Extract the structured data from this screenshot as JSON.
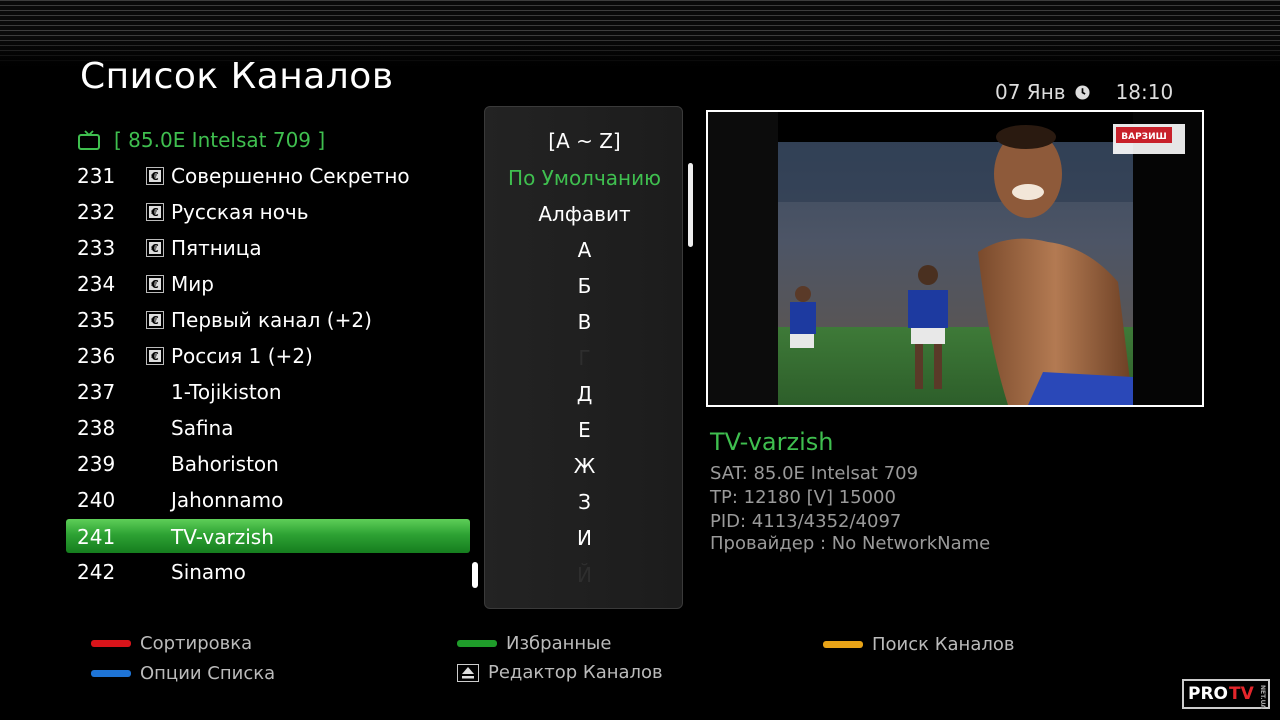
{
  "header": {
    "title": "Список Каналов",
    "date": "07 Янв",
    "time": "18:10"
  },
  "satellite": {
    "label": "[ 85.0E Intelsat 709 ]"
  },
  "channels": [
    {
      "number": "231",
      "name": "Совершенно Секретно",
      "scrambled": true,
      "selected": false
    },
    {
      "number": "232",
      "name": "Русская ночь",
      "scrambled": true,
      "selected": false
    },
    {
      "number": "233",
      "name": "Пятница",
      "scrambled": true,
      "selected": false
    },
    {
      "number": "234",
      "name": "Мир",
      "scrambled": true,
      "selected": false
    },
    {
      "number": "235",
      "name": "Первый канал (+2)",
      "scrambled": true,
      "selected": false
    },
    {
      "number": "236",
      "name": "Россия 1 (+2)",
      "scrambled": true,
      "selected": false
    },
    {
      "number": "237",
      "name": "1-Tojikiston",
      "scrambled": false,
      "selected": false
    },
    {
      "number": "238",
      "name": "Safina",
      "scrambled": false,
      "selected": false
    },
    {
      "number": "239",
      "name": "Bahoriston",
      "scrambled": false,
      "selected": false
    },
    {
      "number": "240",
      "name": "Jahonnamo",
      "scrambled": false,
      "selected": false
    },
    {
      "number": "241",
      "name": "TV-varzish",
      "scrambled": false,
      "selected": true
    },
    {
      "number": "242",
      "name": "Sinamo",
      "scrambled": false,
      "selected": false
    }
  ],
  "sort_panel": {
    "items": [
      {
        "label": "[A ~ Z]",
        "state": "normal"
      },
      {
        "label": "По Умолчанию",
        "state": "active"
      },
      {
        "label": "Алфавит",
        "state": "normal"
      },
      {
        "label": "А",
        "state": "normal"
      },
      {
        "label": "Б",
        "state": "normal"
      },
      {
        "label": "В",
        "state": "normal"
      },
      {
        "label": "Г",
        "state": "disabled"
      },
      {
        "label": "Д",
        "state": "normal"
      },
      {
        "label": "Е",
        "state": "normal"
      },
      {
        "label": "Ж",
        "state": "normal"
      },
      {
        "label": "З",
        "state": "normal"
      },
      {
        "label": "И",
        "state": "normal"
      },
      {
        "label": "Й",
        "state": "disabled"
      }
    ]
  },
  "preview": {
    "overlay_logo": "ВАРЗИШ"
  },
  "channel_info": {
    "name": "TV-varzish",
    "sat": "SAT: 85.0E Intelsat 709",
    "tp": "TP: 12180 [V] 15000",
    "pid": "PID: 4113/4352/4097",
    "provider": "Провайдер : No NetworkName"
  },
  "legend": {
    "sort": {
      "label": "Сортировка",
      "color": "#d8141a"
    },
    "favorites": {
      "label": "Избранные",
      "color": "#1f9c2a"
    },
    "search": {
      "label": "Поиск Каналов",
      "color": "#e8a317"
    },
    "options": {
      "label": "Опции Списка",
      "color": "#1e74d6"
    },
    "editor": {
      "label": "Редактор Каналов"
    }
  },
  "watermark": {
    "pro": "PRO",
    "tv": "TV",
    "net": "NET.UA"
  },
  "colors": {
    "accent_green": "#3fbf4f",
    "background": "#000000"
  }
}
